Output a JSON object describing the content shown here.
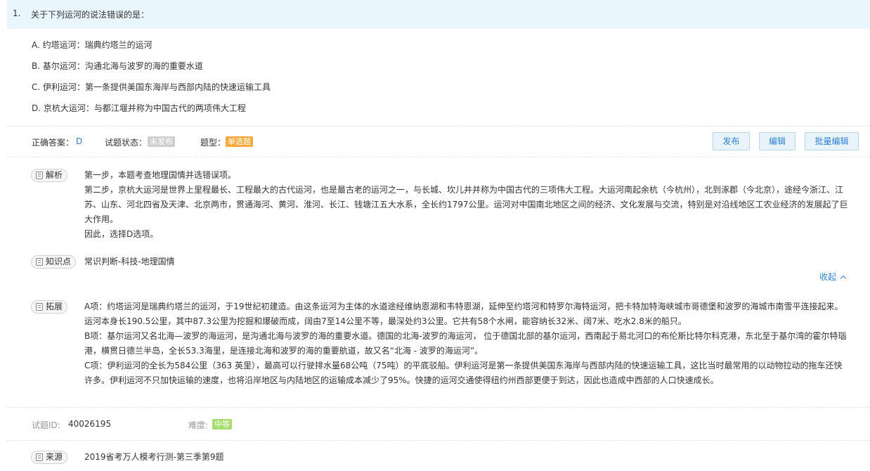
{
  "question": {
    "number": "1.",
    "stem": "关于下列运河的说法错误的是：",
    "options": [
      "A. 约塔运河：瑞典约塔兰的运河",
      "B. 基尔运河：沟通北海与波罗的海的重要水道",
      "C. 伊利运河：第一条提供美国东海岸与西部内陆的快速运输工具",
      "D. 京杭大运河：与都江堰并称为中国古代的两项伟大工程"
    ]
  },
  "meta": {
    "answer_label": "正确答案：",
    "answer_value": "D",
    "status_label": "试题状态：",
    "status_value": "未发布",
    "type_label": "题型：",
    "type_value": "单选题"
  },
  "actions": {
    "publish": "发布",
    "edit": "编辑",
    "batch_edit": "批量编辑"
  },
  "analysis": {
    "tag": "解析",
    "lines": [
      "第一步，本题考查地理国情并选错误项。",
      "第二步，京杭大运河是世界上里程最长、工程最大的古代运河，也是最古老的运河之一，与长城、坎儿井并称为中国古代的三项伟大工程。大运河南起余杭（今杭州），北到涿郡（今北京），途经今浙江、江苏、山东、河北四省及天津、北京两市，贯通海河、黄河、淮河、长江、钱塘江五大水系，全长约1797公里。运河对中国南北地区之间的经济、文化发展与交流，特别是对沿线地区工农业经济的发展起了巨大作用。",
      "因此，选择D选项。"
    ]
  },
  "knowledge": {
    "tag": "知识点",
    "value": "常识判断-科技-地理国情"
  },
  "collapse_label": "收起",
  "extension": {
    "tag": "拓展",
    "lines": [
      "A项：约塔运河是瑞典约塔兰的运河，于19世纪初建造。由这条运河为主体的水道途经维纳恩湖和韦特恩湖，延伸至约塔河和特罗尔海特运河，把卡特加特海峡城市哥德堡和波罗的海城市南雪平连接起来。运河本身长190.5公里，其中87.3公里为挖掘和爆破而成，阔由7至14公里不等，最深处约3公里。它共有58个水闸，能容纳长32米、阔7米、吃水2.8米的船只。",
      "B项：基尔运河又名北海—波罗的海运河，是沟通北海与波罗的海的重要水道。德国的北海-波罗的海运河， 位于德国北部的基尔运河，西南起于易北河口的布伦斯比特尔科克港，东北至于基尔湾的霍尔特瑙港，横贯日德兰半岛，全长53.3海里，是连接北海和波罗的海的重要航道，故又名“北海 - 波罗的海运河”。",
      "C项：伊利运河的全长为584公里（363 英里），最高可以行驶排水量68公吨（75吨）的平底驳船。伊利运河是第一条提供美国东海岸与西部内陆的快速运输工具，这比当时最常用的以动物拉动的拖车还快许多。伊利运河不只加快运输的速度，也将沿岸地区与内陆地区的运输成本减少了95%。快捷的运河交通使得纽约州西部更便于到达，因此也造成中西部的人口快速成长。"
    ]
  },
  "footer": {
    "id_label": "试题ID:",
    "id_value": "40026195",
    "difficulty_label": "难度:",
    "difficulty_value": "中等"
  },
  "source": {
    "tag": "来源",
    "value": "2019省考万人模考行测-第三季第9题"
  },
  "colors": {
    "accent": "#2f80d1",
    "header_bg": "#eaf6fd",
    "badge_orange": "#f7a93b",
    "badge_green": "#a7dc6f",
    "badge_gray": "#cfcfcf"
  }
}
